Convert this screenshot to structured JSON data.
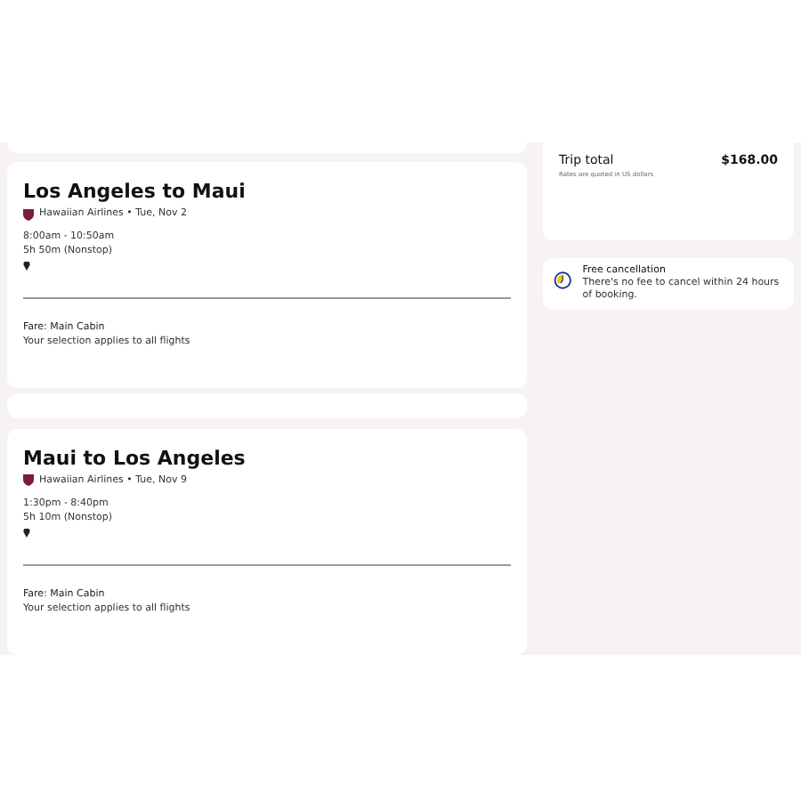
{
  "flights": [
    {
      "title": "Los Angeles to Maui",
      "airline": "Hawaiian Airlines • Tue, Nov 2",
      "times": "8:00am - 10:50am",
      "duration": "5h 50m (Nonstop)",
      "fare": "Fare: Main Cabin",
      "note": "Your selection applies to all flights"
    },
    {
      "title": "Maui to Los Angeles",
      "airline": "Hawaiian Airlines • Tue, Nov 9",
      "times": "1:30pm - 8:40pm",
      "duration": "5h 10m (Nonstop)",
      "fare": "Fare: Main Cabin",
      "note": "Your selection applies to all flights"
    }
  ],
  "summary": {
    "label": "Trip total",
    "amount": "$168.00",
    "note": "Rates are quoted in US dollars"
  },
  "cancellation": {
    "title": "Free cancellation",
    "text": "There's no fee to cancel within 24 hours of booking."
  }
}
